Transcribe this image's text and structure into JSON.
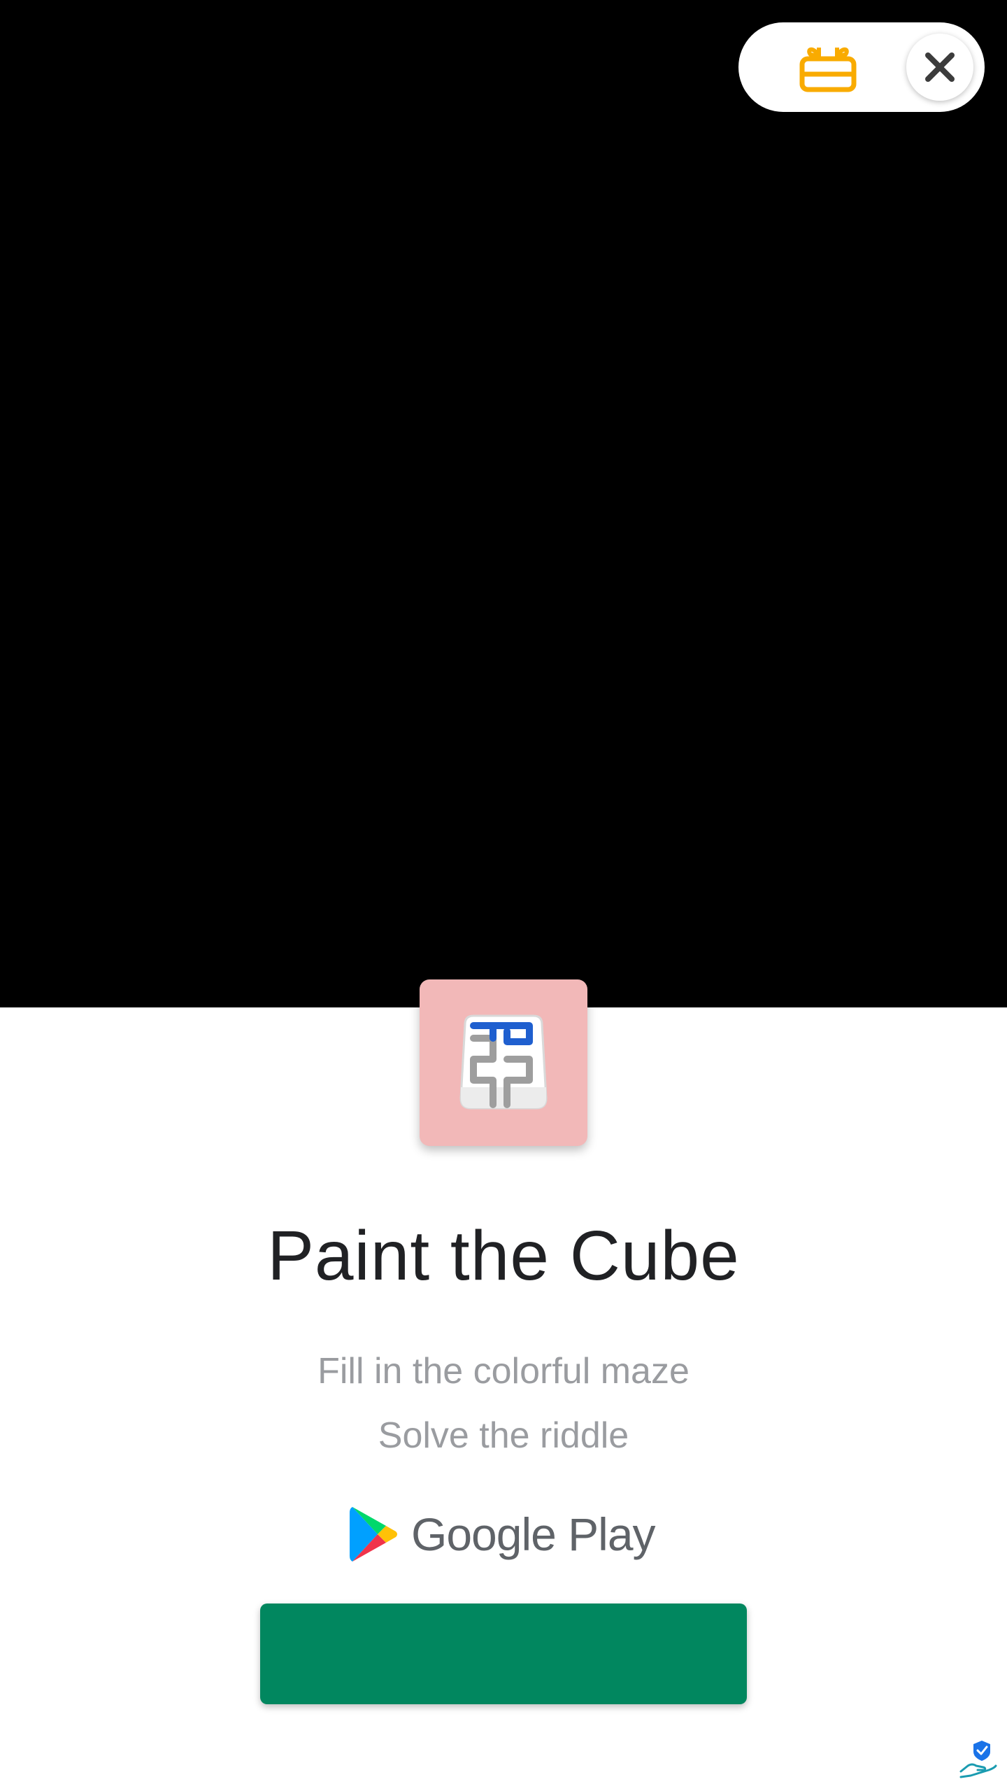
{
  "top_bar": {
    "gift_icon": "gift-box-icon",
    "close_icon": "close-icon",
    "gift_color": "#f9ab00",
    "close_color": "#3c3c3c"
  },
  "app": {
    "title": "Paint the Cube",
    "subtitle_line1": "Fill in the colorful maze",
    "subtitle_line2": "Solve the riddle",
    "icon_background": "#f2b8b8"
  },
  "store": {
    "name": "Google Play",
    "logo_icon": "google-play-logo-icon"
  },
  "install_button": {
    "label": "",
    "color": "#01875f"
  },
  "footer": {
    "ad_icon": "adchoices-icon"
  }
}
